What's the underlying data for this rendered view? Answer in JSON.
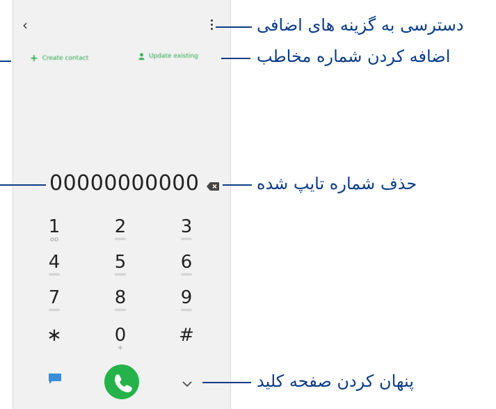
{
  "dialer": {
    "back_icon": "chevron-left-icon",
    "more_icon": "more-vertical-icon",
    "create_contact_label": "Create contact",
    "update_existing_label": "Update existing",
    "number": "00000000000",
    "keys": [
      {
        "digit": "1",
        "sub": "oo"
      },
      {
        "digit": "2",
        "sub": ""
      },
      {
        "digit": "3",
        "sub": ""
      },
      {
        "digit": "4",
        "sub": ""
      },
      {
        "digit": "5",
        "sub": ""
      },
      {
        "digit": "6",
        "sub": ""
      },
      {
        "digit": "7",
        "sub": ""
      },
      {
        "digit": "8",
        "sub": ""
      },
      {
        "digit": "9",
        "sub": ""
      },
      {
        "digit": "∗",
        "sub": ""
      },
      {
        "digit": "0",
        "sub": "+"
      },
      {
        "digit": "#",
        "sub": ""
      }
    ],
    "accent_color": "#26b24a"
  },
  "annotations": {
    "more_options": "دسترسی به گزینه های اضافی",
    "add_contact": "اضافه کردن شماره مخاطب",
    "delete_number": "حذف شماره تایپ شده",
    "hide_keypad": "پنهان کردن صفحه کلید",
    "color": "#0b3c88"
  }
}
